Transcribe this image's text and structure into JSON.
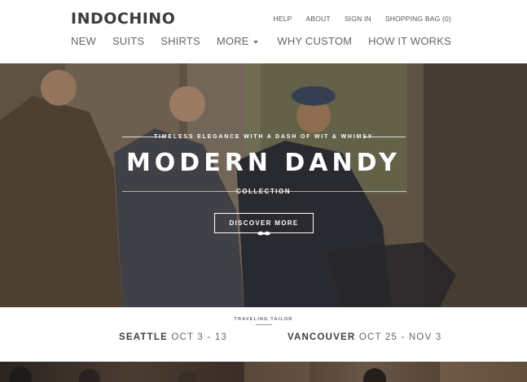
{
  "header": {
    "logo": "INDOCHINO",
    "util_nav": [
      "HELP",
      "ABOUT",
      "SIGN IN",
      "SHOPPING BAG (0)"
    ],
    "main_nav_left": [
      "NEW",
      "SUITS",
      "SHIRTS",
      "MORE"
    ],
    "main_nav_right": [
      "WHY CUSTOM",
      "HOW IT WORKS"
    ]
  },
  "hero": {
    "tagline": "TIMELESS ELEGANCE WITH A DASH OF WIT & WHIMSY",
    "title": "MODERN DANDY",
    "subtitle": "COLLECTION",
    "cta": "DISCOVER MORE",
    "icon": "mustache-icon"
  },
  "traveling_tailor": {
    "label": "TRAVELING TAILOR",
    "stops": [
      {
        "city": "SEATTLE",
        "dates": "OCT 3 - 13"
      },
      {
        "city": "VANCOUVER",
        "dates": "OCT 25 - NOV 3"
      }
    ]
  },
  "colors": {
    "logo": "#3c3c3c",
    "nav": "#666666",
    "hero_text": "#ffffff"
  }
}
